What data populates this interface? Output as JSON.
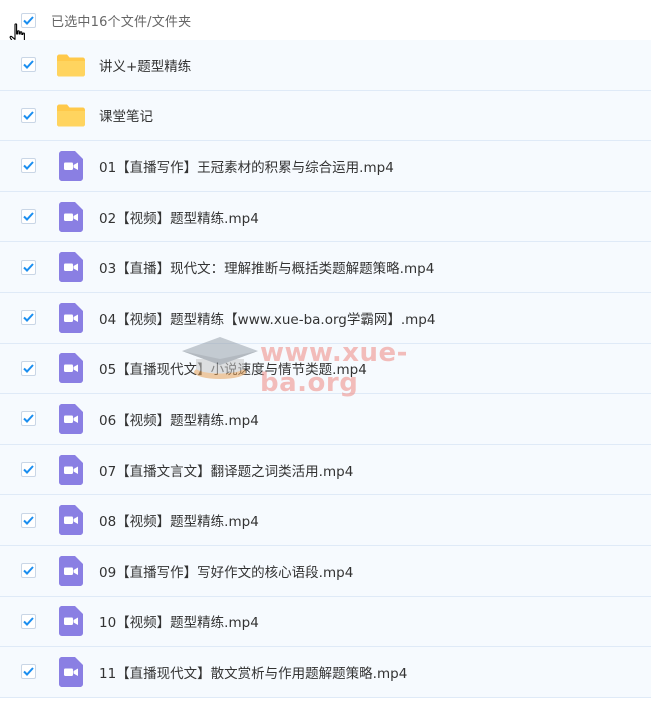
{
  "header": {
    "label": "已选中16个文件/文件夹",
    "checked": true
  },
  "items": [
    {
      "name": "讲义+题型精练",
      "type": "folder",
      "checked": true
    },
    {
      "name": "课堂笔记",
      "type": "folder",
      "checked": true
    },
    {
      "name": "01【直播写作】王冠素材的积累与综合运用.mp4",
      "type": "video",
      "checked": true
    },
    {
      "name": "02【视频】题型精练.mp4",
      "type": "video",
      "checked": true
    },
    {
      "name": "03【直播】现代文：理解推断与概括类题解题策略.mp4",
      "type": "video",
      "checked": true
    },
    {
      "name": "04【视频】题型精练【www.xue-ba.org学霸网】.mp4",
      "type": "video",
      "checked": true
    },
    {
      "name": "05【直播现代文】小说速度与情节类题.mp4",
      "type": "video",
      "checked": true
    },
    {
      "name": "06【视频】题型精练.mp4",
      "type": "video",
      "checked": true
    },
    {
      "name": "07【直播文言文】翻译题之词类活用.mp4",
      "type": "video",
      "checked": true
    },
    {
      "name": "08【视频】题型精练.mp4",
      "type": "video",
      "checked": true
    },
    {
      "name": "09【直播写作】写好作文的核心语段.mp4",
      "type": "video",
      "checked": true
    },
    {
      "name": "10【视频】题型精练.mp4",
      "type": "video",
      "checked": true
    },
    {
      "name": "11【直播现代文】散文赏析与作用题解题策略.mp4",
      "type": "video",
      "checked": true
    }
  ],
  "watermark": {
    "text": "www.xue-ba.org"
  },
  "colors": {
    "checkmark": "#1a8ef0",
    "folder": "#ffc94a",
    "video": "#8a7fe3",
    "row_bg": "#f6fafe",
    "row_border": "#dfeaf7",
    "watermark": "#f08a84"
  }
}
